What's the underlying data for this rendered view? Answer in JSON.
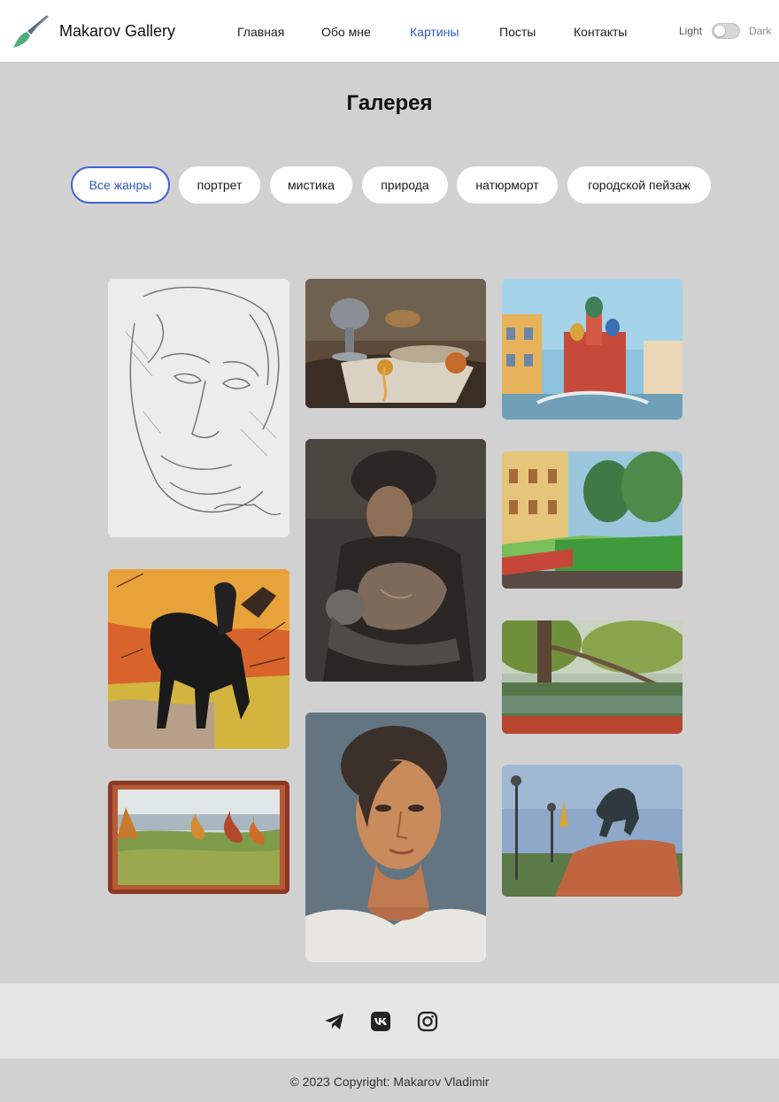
{
  "header": {
    "brand": "Makarov Gallery",
    "logo_icon": "paintbrush-icon",
    "nav": [
      {
        "label": "Главная",
        "active": false
      },
      {
        "label": "Обо мне",
        "active": false
      },
      {
        "label": "Картины",
        "active": true
      },
      {
        "label": "Посты",
        "active": false
      },
      {
        "label": "Контакты",
        "active": false
      }
    ],
    "theme_toggle": {
      "light_label": "Light",
      "dark_label": "Dark",
      "state": "light"
    }
  },
  "gallery": {
    "title": "Галерея",
    "filters": [
      {
        "label": "Все жанры",
        "active": true
      },
      {
        "label": "портрет",
        "active": false
      },
      {
        "label": "мистика",
        "active": false
      },
      {
        "label": "природа",
        "active": false
      },
      {
        "label": "натюрморт",
        "active": false
      },
      {
        "label": "городской пейзаж",
        "active": false
      }
    ],
    "artworks": [
      {
        "name": "pencil-portrait-sketch"
      },
      {
        "name": "horseman-painting"
      },
      {
        "name": "framed-autumn-landscape"
      },
      {
        "name": "still-life-painting"
      },
      {
        "name": "mother-and-child-painting"
      },
      {
        "name": "woman-portrait-painting"
      },
      {
        "name": "church-cityscape-painting"
      },
      {
        "name": "embankment-cityscape-painting"
      },
      {
        "name": "pond-tree-painting"
      },
      {
        "name": "bronze-horseman-painting"
      }
    ]
  },
  "accent_color": "#2e59b8",
  "footer": {
    "social_icons": [
      "telegram-icon",
      "vk-icon",
      "instagram-icon"
    ],
    "copyright": "© 2023 Copyright: Makarov Vladimir"
  }
}
